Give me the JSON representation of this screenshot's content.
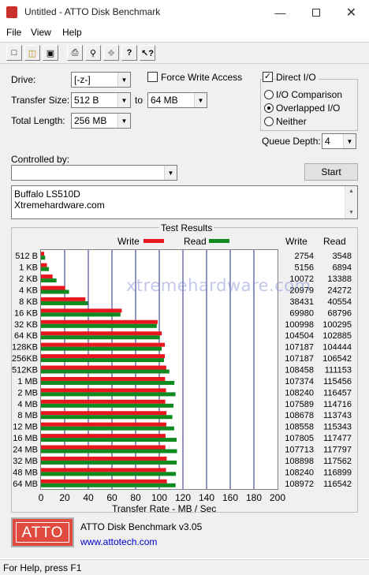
{
  "window": {
    "title": "Untitled - ATTO Disk Benchmark",
    "minimize_icon": "minimize-icon",
    "maximize_icon": "maximize-icon",
    "close_icon": "close-icon"
  },
  "menu": {
    "file": "File",
    "view": "View",
    "help": "Help"
  },
  "toolbar": {
    "icons": [
      "new-icon",
      "open-icon",
      "save-icon",
      "print-icon",
      "print-preview-icon",
      "move-icon",
      "help-icon",
      "context-help-icon"
    ]
  },
  "settings": {
    "drive_label": "Drive:",
    "drive_value": "[-z-]",
    "transfer_size_label": "Transfer Size:",
    "transfer_from": "512 B",
    "to_label": "to",
    "transfer_to": "64 MB",
    "total_length_label": "Total Length:",
    "total_length": "256 MB",
    "force_write_label": "Force Write Access",
    "force_write_checked": false,
    "direct_io_label": "Direct I/O",
    "direct_io_checked": true,
    "io_comparison_label": "I/O Comparison",
    "overlapped_io_label": "Overlapped I/O",
    "neither_label": "Neither",
    "selected_mode": "Overlapped I/O",
    "queue_depth_label": "Queue Depth:",
    "queue_depth": "4",
    "controlled_by_label": "Controlled by:",
    "controlled_by_value": "",
    "start_label": "Start",
    "description_line1": "Buffalo LS510D",
    "description_line2": "Xtremehardware.com"
  },
  "results": {
    "group_title": "Test Results",
    "write_legend": "Write",
    "read_legend": "Read",
    "write_col": "Write",
    "read_col": "Read",
    "x_axis_title": "Transfer Rate - MB / Sec",
    "watermark": "xtremehardware.com",
    "write_color": "#e8161e",
    "read_color": "#0f8a1f"
  },
  "chart_data": {
    "type": "bar",
    "orientation": "horizontal",
    "categories": [
      "512 B",
      "1 KB",
      "2 KB",
      "4 KB",
      "8 KB",
      "16 KB",
      "32 KB",
      "64 KB",
      "128KB",
      "256KB",
      "512KB",
      "1 MB",
      "2 MB",
      "4 MB",
      "8 MB",
      "12 MB",
      "16 MB",
      "24 MB",
      "32 MB",
      "48 MB",
      "64 MB"
    ],
    "series": [
      {
        "name": "Write",
        "values": [
          2.7,
          5.0,
          9.8,
          20.5,
          37.5,
          68.3,
          98.6,
          102.1,
          104.7,
          104.7,
          105.9,
          104.9,
          105.7,
          105.1,
          106.1,
          106.0,
          105.3,
          105.2,
          106.3,
          105.7,
          106.4
        ]
      },
      {
        "name": "Read",
        "values": [
          3.5,
          6.7,
          13.1,
          23.7,
          39.6,
          67.2,
          97.9,
          100.5,
          102.0,
          104.0,
          108.5,
          112.8,
          113.7,
          112.0,
          111.1,
          112.6,
          114.7,
          115.0,
          114.8,
          114.1,
          113.8
        ]
      }
    ],
    "write_kbps": [
      "2754",
      "5156",
      "10072",
      "20979",
      "38431",
      "69980",
      "100998",
      "104504",
      "107187",
      "107187",
      "108458",
      "107374",
      "108240",
      "107589",
      "108678",
      "108558",
      "107805",
      "107713",
      "108898",
      "108240",
      "108972"
    ],
    "read_kbps": [
      "3548",
      "6894",
      "13388",
      "24272",
      "40554",
      "68796",
      "100295",
      "102885",
      "104444",
      "106542",
      "111153",
      "115456",
      "116457",
      "114716",
      "113743",
      "115343",
      "117477",
      "117797",
      "117562",
      "116899",
      "116542"
    ],
    "xlim": [
      0,
      200
    ],
    "xticks": [
      "0",
      "20",
      "40",
      "60",
      "80",
      "100",
      "120",
      "140",
      "160",
      "180",
      "200"
    ],
    "xlabel": "Transfer Rate - MB / Sec",
    "grid": true
  },
  "footer": {
    "logo_text": "ATTO",
    "product": "ATTO Disk Benchmark v3.05",
    "link": "www.attotech.com"
  },
  "status": {
    "text": "For Help, press F1"
  }
}
